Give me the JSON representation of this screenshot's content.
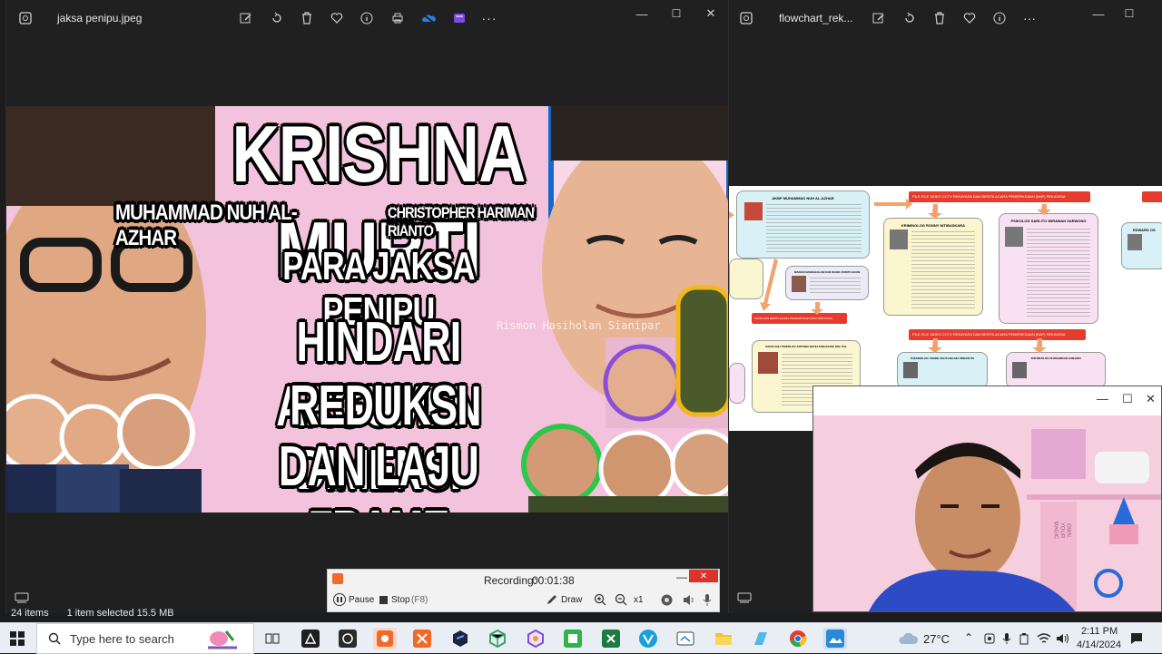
{
  "window1": {
    "title": "jaksa penipu.jpeg",
    "controls": {
      "minimize": "—",
      "maximize": "☐",
      "close": "✕"
    },
    "toolbar_icons": [
      "edit-icon",
      "rotate-icon",
      "delete-icon",
      "favorite-icon",
      "info-icon",
      "print-icon",
      "onedrive-icon",
      "clipchamp-icon",
      "more-icon"
    ]
  },
  "poster": {
    "headline": "KRISHNA MURTI",
    "name1": "MUHAMMAD NUH AL-AZHAR",
    "name2": "CHRISTOPHER HARIMAN RIANTO",
    "line1": "PARA JAKSA PENIPU",
    "line2": "HINDARI ARGUMEN",
    "line3": "REDUKSI DIMENSI",
    "line4": "DAN LAJU FRAME",
    "watermark": "Rismon Hasiholan Sianipar",
    "colors": {
      "bg": "#f5c5de",
      "blue": "#1565c0",
      "text": "#ffffff"
    }
  },
  "recording": {
    "status": "Recording:",
    "time": "00:01:38",
    "pause_label": "Pause",
    "stop_label": "Stop",
    "stop_shortcut": "(F8)",
    "draw_label": "Draw",
    "zoom_level": "x1"
  },
  "window2": {
    "title": "flowchart_rek...",
    "controls": {
      "minimize": "—",
      "maximize": "☐"
    },
    "flowchart": {
      "red1": "FILE-FILE VIDEO CCTV REKAYASA DAN BERITA ACARA PEMERIKSAAN (BAP) REKAYASA",
      "red2": "FILE-FILE VIDEO CCTV REKAYASA DAN BERITA ACARA PEMERIKSAAN (BAP) REKAYASA",
      "red3": "SAKSI DAN BERITA ACARA PEMERIKSAAN (BAP) REKAYASA",
      "card1": "AKBP MUHAMMAD NUH AL-AZHAR",
      "card2": "KRIMINOLOG RONNY NITIBASKARA",
      "card3": "PSIKOLOG SARLITO WIRAWAN SARWONO",
      "card4": "MARLIN NAINGGOLAN DAN RANDI JUWITA BOUN",
      "card5": "SAKSI AHLI PSIKOLOG ANTONIA RATIH ANDJAYANI, MSi, PAL",
      "card6": "TOKSIKOLOG I MADE AGUS GELGEL WIRASUTA",
      "card7": "TOKSIKOLOG NURSAMRAN SUBANDI",
      "card8": "EDWARD OS"
    }
  },
  "webcam": {
    "controls": {
      "minimize": "—",
      "maximize": "☐",
      "close": "✕"
    },
    "wall_text": "OWN YOUR MAGIC"
  },
  "explorer_status": {
    "items": "24 items",
    "selected": "1 item selected  15.5 MB"
  },
  "taskbar": {
    "search_placeholder": "Type here to search",
    "temperature": "27°C",
    "time": "2:11 PM",
    "date": "4/14/2024",
    "weather_icon": "cloud-icon",
    "accent": "#0078d4"
  }
}
